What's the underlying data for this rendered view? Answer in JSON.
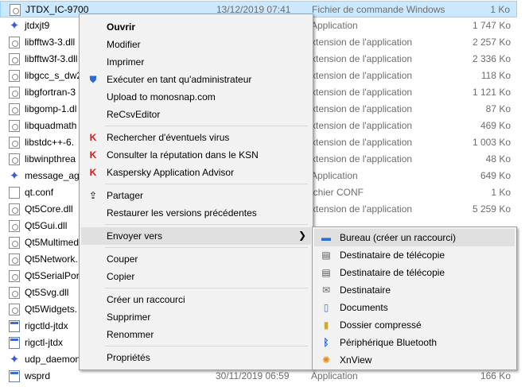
{
  "files": [
    {
      "name": "JTDX_IC-9700",
      "date": "13/12/2019 07:41",
      "type": "Fichier de commande Windows",
      "size": "1 Ko",
      "icon": "document-icon",
      "selected": true
    },
    {
      "name": "jtdxjt9",
      "date": "",
      "type": "Application",
      "size": "1 747 Ko",
      "icon": "exe-icon"
    },
    {
      "name": "libfftw3-3.dll",
      "date": "",
      "type": "xtension de l'application",
      "size": "2 257 Ko",
      "icon": "dll-icon"
    },
    {
      "name": "libfftw3f-3.dll",
      "date": "",
      "type": "xtension de l'application",
      "size": "2 336 Ko",
      "icon": "dll-icon"
    },
    {
      "name": "libgcc_s_dw2",
      "date": "",
      "type": "xtension de l'application",
      "size": "118 Ko",
      "icon": "dll-icon"
    },
    {
      "name": "libgfortran-3",
      "date": "",
      "type": "xtension de l'application",
      "size": "1 121 Ko",
      "icon": "dll-icon"
    },
    {
      "name": "libgomp-1.dl",
      "date": "",
      "type": "xtension de l'application",
      "size": "87 Ko",
      "icon": "dll-icon"
    },
    {
      "name": "libquadmath",
      "date": "",
      "type": "xtension de l'application",
      "size": "469 Ko",
      "icon": "dll-icon"
    },
    {
      "name": "libstdc++-6.",
      "date": "",
      "type": "xtension de l'application",
      "size": "1 003 Ko",
      "icon": "dll-icon"
    },
    {
      "name": "libwinpthrea",
      "date": "",
      "type": "xtension de l'application",
      "size": "48 Ko",
      "icon": "dll-icon"
    },
    {
      "name": "message_agg",
      "date": "",
      "type": "Application",
      "size": "649 Ko",
      "icon": "exe-icon"
    },
    {
      "name": "qt.conf",
      "date": "",
      "type": "ichier CONF",
      "size": "1 Ko",
      "icon": "file-icon"
    },
    {
      "name": "Qt5Core.dll",
      "date": "",
      "type": "xtension de l'application",
      "size": "5 259 Ko",
      "icon": "dll-icon"
    },
    {
      "name": "Qt5Gui.dll",
      "date": "",
      "type": "",
      "size": "",
      "icon": "dll-icon"
    },
    {
      "name": "Qt5Multimed",
      "date": "",
      "type": "",
      "size": "",
      "icon": "dll-icon"
    },
    {
      "name": "Qt5Network.",
      "date": "",
      "type": "",
      "size": "",
      "icon": "dll-icon"
    },
    {
      "name": "Qt5SerialPort",
      "date": "",
      "type": "",
      "size": "",
      "icon": "dll-icon"
    },
    {
      "name": "Qt5Svg.dll",
      "date": "",
      "type": "",
      "size": "",
      "icon": "dll-icon"
    },
    {
      "name": "Qt5Widgets.",
      "date": "",
      "type": "",
      "size": "",
      "icon": "dll-icon"
    },
    {
      "name": "rigctld-jtdx",
      "date": "",
      "type": "",
      "size": "",
      "icon": "window-icon"
    },
    {
      "name": "rigctl-jtdx",
      "date": "",
      "type": "",
      "size": "",
      "icon": "window-icon"
    },
    {
      "name": "udp_daemon",
      "date": "",
      "type": "",
      "size": "",
      "icon": "exe-icon"
    },
    {
      "name": "wsprd",
      "date": "30/11/2019 06:59",
      "type": "Application",
      "size": "166 Ko",
      "icon": "window-icon"
    }
  ],
  "context_menu": {
    "items": [
      {
        "label": "Ouvrir",
        "bold": true,
        "icon": ""
      },
      {
        "label": "Modifier",
        "icon": ""
      },
      {
        "label": "Imprimer",
        "icon": ""
      },
      {
        "label": "Exécuter en tant qu'administrateur",
        "icon": "shield-icon"
      },
      {
        "label": "Upload to monosnap.com",
        "icon": ""
      },
      {
        "label": "ReCsvEditor",
        "icon": ""
      },
      {
        "label": "Rechercher d'éventuels virus",
        "icon": "kaspersky-icon"
      },
      {
        "label": "Consulter la réputation dans le KSN",
        "icon": "kaspersky-icon"
      },
      {
        "label": "Kaspersky Application Advisor",
        "icon": "kaspersky-icon"
      },
      {
        "label": "Partager",
        "icon": "share-icon"
      },
      {
        "label": "Restaurer les versions précédentes",
        "icon": ""
      },
      {
        "label": "Envoyer vers",
        "icon": "",
        "submenu": true,
        "hover": true
      },
      {
        "label": "Couper",
        "icon": ""
      },
      {
        "label": "Copier",
        "icon": ""
      },
      {
        "label": "Créer un raccourci",
        "icon": ""
      },
      {
        "label": "Supprimer",
        "icon": ""
      },
      {
        "label": "Renommer",
        "icon": ""
      },
      {
        "label": "Propriétés",
        "icon": ""
      }
    ]
  },
  "send_to_menu": {
    "items": [
      {
        "label": "Bureau (créer un raccourci)",
        "icon": "desktop-icon",
        "hover": true
      },
      {
        "label": "Destinataire de télécopie",
        "icon": "fax-icon"
      },
      {
        "label": "Destinataire de télécopie",
        "icon": "fax-icon"
      },
      {
        "label": "Destinataire",
        "icon": "mail-icon"
      },
      {
        "label": "Documents",
        "icon": "documents-icon"
      },
      {
        "label": "Dossier compressé",
        "icon": "zip-folder-icon"
      },
      {
        "label": "Périphérique Bluetooth",
        "icon": "bluetooth-icon"
      },
      {
        "label": "XnView",
        "icon": "xnview-icon"
      }
    ]
  }
}
